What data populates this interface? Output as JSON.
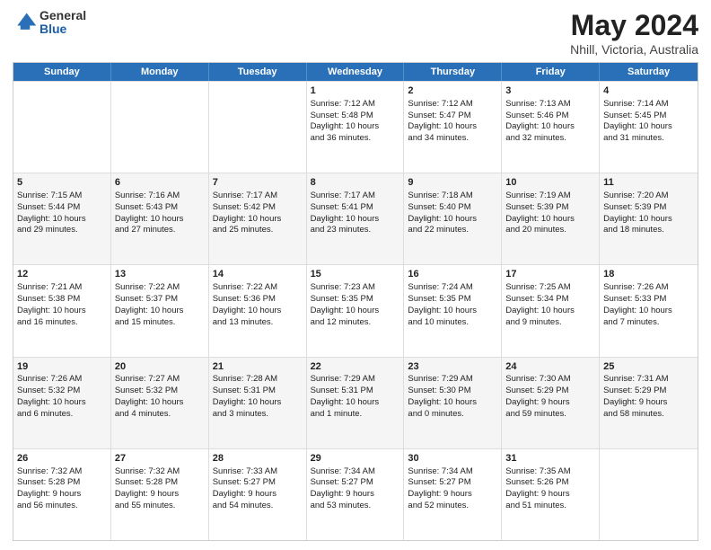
{
  "logo": {
    "general": "General",
    "blue": "Blue"
  },
  "title": {
    "month": "May 2024",
    "location": "Nhill, Victoria, Australia"
  },
  "header_days": [
    "Sunday",
    "Monday",
    "Tuesday",
    "Wednesday",
    "Thursday",
    "Friday",
    "Saturday"
  ],
  "rows": [
    {
      "alt": false,
      "cells": [
        {
          "day": "",
          "lines": []
        },
        {
          "day": "",
          "lines": []
        },
        {
          "day": "",
          "lines": []
        },
        {
          "day": "1",
          "lines": [
            "Sunrise: 7:12 AM",
            "Sunset: 5:48 PM",
            "Daylight: 10 hours",
            "and 36 minutes."
          ]
        },
        {
          "day": "2",
          "lines": [
            "Sunrise: 7:12 AM",
            "Sunset: 5:47 PM",
            "Daylight: 10 hours",
            "and 34 minutes."
          ]
        },
        {
          "day": "3",
          "lines": [
            "Sunrise: 7:13 AM",
            "Sunset: 5:46 PM",
            "Daylight: 10 hours",
            "and 32 minutes."
          ]
        },
        {
          "day": "4",
          "lines": [
            "Sunrise: 7:14 AM",
            "Sunset: 5:45 PM",
            "Daylight: 10 hours",
            "and 31 minutes."
          ]
        }
      ]
    },
    {
      "alt": true,
      "cells": [
        {
          "day": "5",
          "lines": [
            "Sunrise: 7:15 AM",
            "Sunset: 5:44 PM",
            "Daylight: 10 hours",
            "and 29 minutes."
          ]
        },
        {
          "day": "6",
          "lines": [
            "Sunrise: 7:16 AM",
            "Sunset: 5:43 PM",
            "Daylight: 10 hours",
            "and 27 minutes."
          ]
        },
        {
          "day": "7",
          "lines": [
            "Sunrise: 7:17 AM",
            "Sunset: 5:42 PM",
            "Daylight: 10 hours",
            "and 25 minutes."
          ]
        },
        {
          "day": "8",
          "lines": [
            "Sunrise: 7:17 AM",
            "Sunset: 5:41 PM",
            "Daylight: 10 hours",
            "and 23 minutes."
          ]
        },
        {
          "day": "9",
          "lines": [
            "Sunrise: 7:18 AM",
            "Sunset: 5:40 PM",
            "Daylight: 10 hours",
            "and 22 minutes."
          ]
        },
        {
          "day": "10",
          "lines": [
            "Sunrise: 7:19 AM",
            "Sunset: 5:39 PM",
            "Daylight: 10 hours",
            "and 20 minutes."
          ]
        },
        {
          "day": "11",
          "lines": [
            "Sunrise: 7:20 AM",
            "Sunset: 5:39 PM",
            "Daylight: 10 hours",
            "and 18 minutes."
          ]
        }
      ]
    },
    {
      "alt": false,
      "cells": [
        {
          "day": "12",
          "lines": [
            "Sunrise: 7:21 AM",
            "Sunset: 5:38 PM",
            "Daylight: 10 hours",
            "and 16 minutes."
          ]
        },
        {
          "day": "13",
          "lines": [
            "Sunrise: 7:22 AM",
            "Sunset: 5:37 PM",
            "Daylight: 10 hours",
            "and 15 minutes."
          ]
        },
        {
          "day": "14",
          "lines": [
            "Sunrise: 7:22 AM",
            "Sunset: 5:36 PM",
            "Daylight: 10 hours",
            "and 13 minutes."
          ]
        },
        {
          "day": "15",
          "lines": [
            "Sunrise: 7:23 AM",
            "Sunset: 5:35 PM",
            "Daylight: 10 hours",
            "and 12 minutes."
          ]
        },
        {
          "day": "16",
          "lines": [
            "Sunrise: 7:24 AM",
            "Sunset: 5:35 PM",
            "Daylight: 10 hours",
            "and 10 minutes."
          ]
        },
        {
          "day": "17",
          "lines": [
            "Sunrise: 7:25 AM",
            "Sunset: 5:34 PM",
            "Daylight: 10 hours",
            "and 9 minutes."
          ]
        },
        {
          "day": "18",
          "lines": [
            "Sunrise: 7:26 AM",
            "Sunset: 5:33 PM",
            "Daylight: 10 hours",
            "and 7 minutes."
          ]
        }
      ]
    },
    {
      "alt": true,
      "cells": [
        {
          "day": "19",
          "lines": [
            "Sunrise: 7:26 AM",
            "Sunset: 5:32 PM",
            "Daylight: 10 hours",
            "and 6 minutes."
          ]
        },
        {
          "day": "20",
          "lines": [
            "Sunrise: 7:27 AM",
            "Sunset: 5:32 PM",
            "Daylight: 10 hours",
            "and 4 minutes."
          ]
        },
        {
          "day": "21",
          "lines": [
            "Sunrise: 7:28 AM",
            "Sunset: 5:31 PM",
            "Daylight: 10 hours",
            "and 3 minutes."
          ]
        },
        {
          "day": "22",
          "lines": [
            "Sunrise: 7:29 AM",
            "Sunset: 5:31 PM",
            "Daylight: 10 hours",
            "and 1 minute."
          ]
        },
        {
          "day": "23",
          "lines": [
            "Sunrise: 7:29 AM",
            "Sunset: 5:30 PM",
            "Daylight: 10 hours",
            "and 0 minutes."
          ]
        },
        {
          "day": "24",
          "lines": [
            "Sunrise: 7:30 AM",
            "Sunset: 5:29 PM",
            "Daylight: 9 hours",
            "and 59 minutes."
          ]
        },
        {
          "day": "25",
          "lines": [
            "Sunrise: 7:31 AM",
            "Sunset: 5:29 PM",
            "Daylight: 9 hours",
            "and 58 minutes."
          ]
        }
      ]
    },
    {
      "alt": false,
      "cells": [
        {
          "day": "26",
          "lines": [
            "Sunrise: 7:32 AM",
            "Sunset: 5:28 PM",
            "Daylight: 9 hours",
            "and 56 minutes."
          ]
        },
        {
          "day": "27",
          "lines": [
            "Sunrise: 7:32 AM",
            "Sunset: 5:28 PM",
            "Daylight: 9 hours",
            "and 55 minutes."
          ]
        },
        {
          "day": "28",
          "lines": [
            "Sunrise: 7:33 AM",
            "Sunset: 5:27 PM",
            "Daylight: 9 hours",
            "and 54 minutes."
          ]
        },
        {
          "day": "29",
          "lines": [
            "Sunrise: 7:34 AM",
            "Sunset: 5:27 PM",
            "Daylight: 9 hours",
            "and 53 minutes."
          ]
        },
        {
          "day": "30",
          "lines": [
            "Sunrise: 7:34 AM",
            "Sunset: 5:27 PM",
            "Daylight: 9 hours",
            "and 52 minutes."
          ]
        },
        {
          "day": "31",
          "lines": [
            "Sunrise: 7:35 AM",
            "Sunset: 5:26 PM",
            "Daylight: 9 hours",
            "and 51 minutes."
          ]
        },
        {
          "day": "",
          "lines": []
        }
      ]
    }
  ]
}
